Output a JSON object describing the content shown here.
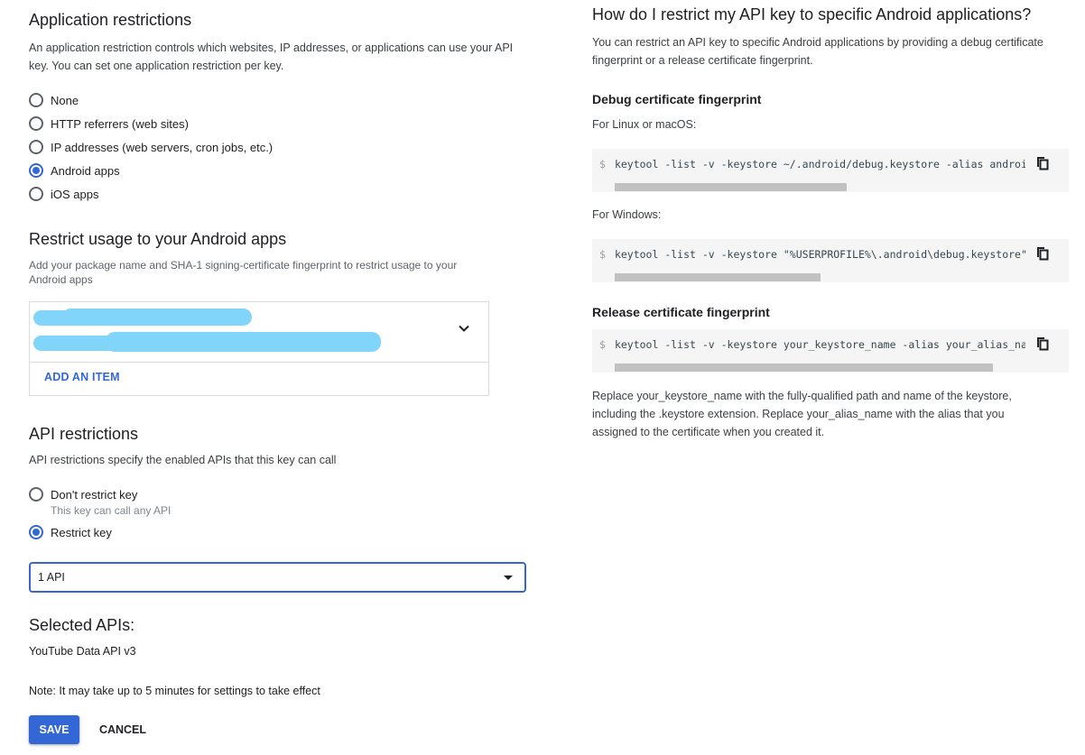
{
  "app_restrictions": {
    "title": "Application restrictions",
    "description": "An application restriction controls which websites, IP addresses, or applications can use your API key. You can set one application restriction per key.",
    "options": [
      {
        "label": "None",
        "checked": false
      },
      {
        "label": "HTTP referrers (web sites)",
        "checked": false
      },
      {
        "label": "IP addresses (web servers, cron jobs, etc.)",
        "checked": false
      },
      {
        "label": "Android apps",
        "checked": true
      },
      {
        "label": "iOS apps",
        "checked": false
      }
    ]
  },
  "android_apps": {
    "title": "Restrict usage to your Android apps",
    "description": "Add your package name and SHA-1 signing-certificate fingerprint to restrict usage to your Android apps",
    "item_redacted": true,
    "add_item_label": "ADD AN ITEM"
  },
  "api_restrictions": {
    "title": "API restrictions",
    "description": "API restrictions specify the enabled APIs that this key can call",
    "options": [
      {
        "label": "Don't restrict key",
        "sublabel": "This key can call any API",
        "checked": false
      },
      {
        "label": "Restrict key",
        "checked": true
      }
    ],
    "select_value": "1 API",
    "selected_apis_title": "Selected APIs:",
    "selected_apis": [
      "YouTube Data API v3"
    ],
    "note": "Note: It may take up to 5 minutes for settings to take effect"
  },
  "actions": {
    "save_label": "SAVE",
    "cancel_label": "CANCEL"
  },
  "help": {
    "title": "How do I restrict my API key to specific Android applications?",
    "intro": "You can restrict an API key to specific Android applications by providing a debug certificate fingerprint or a release certificate fingerprint.",
    "debug_title": "Debug certificate fingerprint",
    "linux_label": "For Linux or macOS:",
    "linux_cmd": "keytool -list -v -keystore ~/.android/debug.keystore -alias androiddebugkey -storepass android -keypass android",
    "windows_label": "For Windows:",
    "windows_cmd": "keytool -list -v -keystore \"%USERPROFILE%\\.android\\debug.keystore\" -alias androiddebugkey -storepass android -keypass android",
    "release_title": "Release certificate fingerprint",
    "release_cmd": "keytool -list -v -keystore your_keystore_name -alias your_alias_name",
    "prompt": "$",
    "footer": "Replace your_keystore_name with the fully-qualified path and name of the keystore, including the .keystore extension. Replace your_alias_name with the alias that you assigned to the certificate when you created it."
  },
  "colors": {
    "accent": "#3367d6",
    "redaction": "#81d4fa",
    "code_bg": "#f5f5f5"
  }
}
